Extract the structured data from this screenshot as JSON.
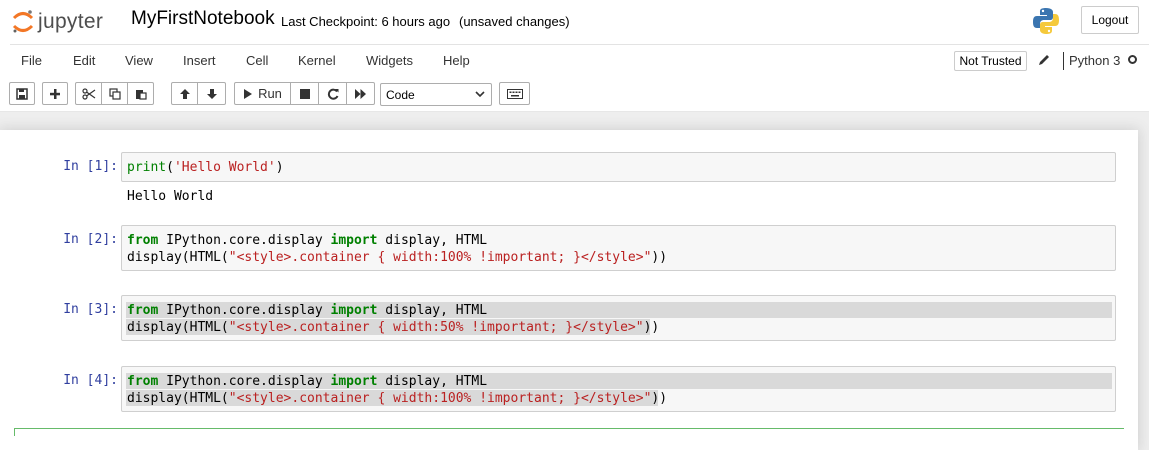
{
  "header": {
    "logo_text": "jupyter",
    "notebook_name": "MyFirstNotebook",
    "checkpoint": "Last Checkpoint: 6 hours ago",
    "unsaved": "(unsaved changes)",
    "logout_label": "Logout"
  },
  "menu": {
    "items": [
      "File",
      "Edit",
      "View",
      "Insert",
      "Cell",
      "Kernel",
      "Widgets",
      "Help"
    ],
    "trusted_label": "Not Trusted",
    "kernel_name": "Python 3"
  },
  "toolbar": {
    "run_label": "Run",
    "cell_type": "Code",
    "icons": [
      "save-icon",
      "plus-icon",
      "scissors-icon",
      "copy-icon",
      "paste-icon",
      "arrow-up-icon",
      "arrow-down-icon",
      "play-icon",
      "stop-icon",
      "restart-icon",
      "fast-forward-icon",
      "keyboard-icon"
    ]
  },
  "cells": [
    {
      "prompt": "In [1]:",
      "code": [
        [
          {
            "t": "print",
            "c": "fn"
          },
          {
            "t": "(",
            "c": ""
          },
          {
            "t": "'Hello World'",
            "c": "str"
          },
          {
            "t": ")",
            "c": ""
          }
        ]
      ],
      "output": "Hello World"
    },
    {
      "prompt": "In [2]:",
      "code": [
        [
          {
            "t": "from",
            "c": "kw"
          },
          {
            "t": " IPython.core.display ",
            "c": ""
          },
          {
            "t": "import",
            "c": "kw"
          },
          {
            "t": " display, HTML",
            "c": ""
          }
        ],
        [
          {
            "t": "display(HTML(",
            "c": ""
          },
          {
            "t": "\"<style>.container { width:100% !important; }</style>\"",
            "c": "str"
          },
          {
            "t": "))",
            "c": ""
          }
        ]
      ]
    },
    {
      "prompt": "In [3]:",
      "code": [
        [
          {
            "t": "from",
            "c": "kw"
          },
          {
            "t": " IPython.core.display ",
            "c": ""
          },
          {
            "t": "import",
            "c": "kw"
          },
          {
            "t": " display, HTML",
            "c": ""
          }
        ],
        [
          {
            "t": "display(HTML(",
            "c": ""
          },
          {
            "t": "\"<style>.container { width:50% !important; }</style>\"",
            "c": "str"
          },
          {
            "t": "))",
            "c": ""
          }
        ]
      ]
    },
    {
      "prompt": "In [4]:",
      "code": [
        [
          {
            "t": "from",
            "c": "kw"
          },
          {
            "t": " IPython.core.display ",
            "c": ""
          },
          {
            "t": "import",
            "c": "kw"
          },
          {
            "t": " display, HTML",
            "c": ""
          }
        ],
        [
          {
            "t": "display(HTML(",
            "c": ""
          },
          {
            "t": "\"<style>.container { width:100% !important; }</style>\"",
            "c": "str"
          },
          {
            "t": "))",
            "c": ""
          }
        ]
      ]
    }
  ]
}
